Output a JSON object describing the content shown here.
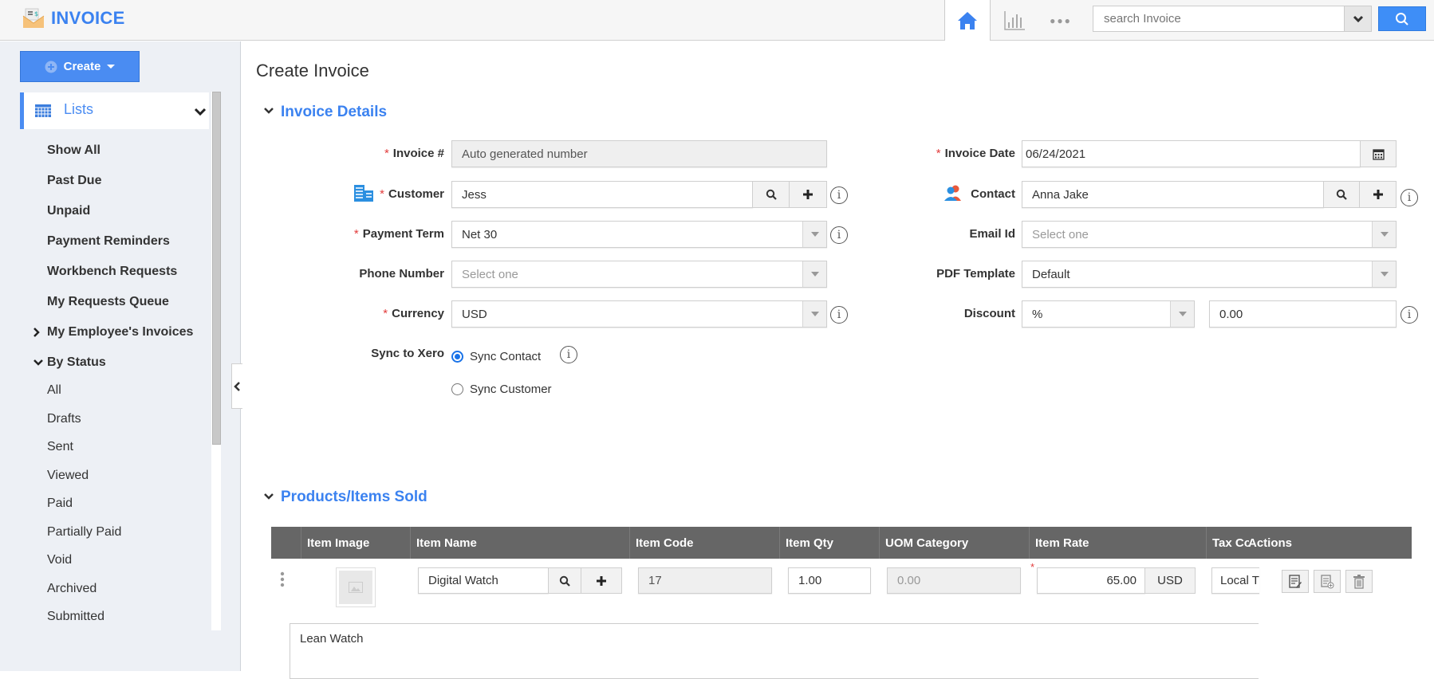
{
  "header": {
    "app_title": "INVOICE",
    "logo_icon": "envelope-invoice-icon",
    "nav": [
      {
        "name": "home",
        "icon": "home-icon"
      },
      {
        "name": "reports",
        "icon": "bar-chart-icon"
      },
      {
        "name": "more",
        "icon": "more-dots-icon",
        "glyph": "●●●"
      }
    ],
    "search": {
      "placeholder": "search Invoice",
      "value": ""
    }
  },
  "sidebar": {
    "create_label": "Create",
    "lists_label": "Lists",
    "items": [
      {
        "label": "Show All"
      },
      {
        "label": "Past Due"
      },
      {
        "label": "Unpaid"
      },
      {
        "label": "Payment Reminders"
      },
      {
        "label": "Workbench Requests"
      },
      {
        "label": "My Requests Queue"
      },
      {
        "label": "My Employee's Invoices",
        "expandable": true,
        "expanded": false
      },
      {
        "label": "By Status",
        "expandable": true,
        "expanded": true
      }
    ],
    "status_items": [
      {
        "label": "All"
      },
      {
        "label": "Drafts"
      },
      {
        "label": "Sent"
      },
      {
        "label": "Viewed"
      },
      {
        "label": "Paid"
      },
      {
        "label": "Partially Paid"
      },
      {
        "label": "Void"
      },
      {
        "label": "Archived"
      },
      {
        "label": "Submitted"
      }
    ]
  },
  "main": {
    "page_title": "Create Invoice",
    "invoice_details": {
      "title": "Invoice Details",
      "left": {
        "invoice_no": {
          "label": "Invoice #",
          "required": true,
          "value": "Auto generated number"
        },
        "customer": {
          "label": "Customer",
          "required": true,
          "value": "Jess"
        },
        "payment_term": {
          "label": "Payment Term",
          "required": true,
          "value": "Net 30"
        },
        "phone_number": {
          "label": "Phone Number",
          "required": false,
          "placeholder": "Select one"
        },
        "currency": {
          "label": "Currency",
          "required": true,
          "value": "USD"
        },
        "sync_to_xero": {
          "label": "Sync to Xero",
          "options": [
            {
              "label": "Sync Contact",
              "selected": true
            },
            {
              "label": "Sync Customer",
              "selected": false
            }
          ]
        }
      },
      "right": {
        "invoice_date": {
          "label": "Invoice Date",
          "required": true,
          "value": "06/24/2021"
        },
        "contact": {
          "label": "Contact",
          "required": false,
          "value": "Anna Jake"
        },
        "email_id": {
          "label": "Email Id",
          "placeholder": "Select one"
        },
        "pdf_template": {
          "label": "PDF Template",
          "value": "Default"
        },
        "discount": {
          "label": "Discount",
          "type_value": "%",
          "amount": "0.00"
        }
      },
      "required_mark": "*",
      "info_glyph": "i"
    },
    "products": {
      "title": "Products/Items Sold",
      "columns": [
        "Item Image",
        "Item Name",
        "Item Code",
        "Item Qty",
        "UOM Category",
        "Item Rate",
        "Tax Co",
        "Actions"
      ],
      "rows": [
        {
          "item_name": "Digital Watch",
          "item_code": "17",
          "item_qty": "1.00",
          "uom_category": "0.00",
          "item_rate": "65.00",
          "currency": "USD",
          "tax_code": "Local T",
          "description": "Lean Watch"
        }
      ],
      "rate_required_mark": "*"
    }
  }
}
